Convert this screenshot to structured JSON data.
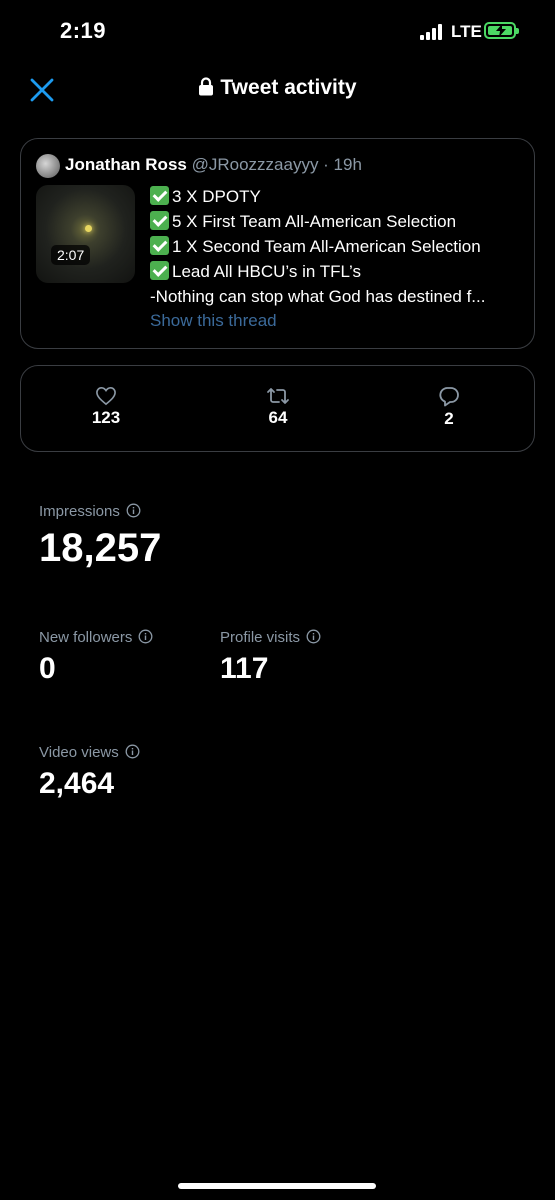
{
  "status_bar": {
    "time": "2:19",
    "network": "LTE"
  },
  "header": {
    "title": "Tweet activity"
  },
  "tweet": {
    "author_name": "Jonathan Ross",
    "meta": "@JRoozzzaayyy · 19h",
    "video_duration": "2:07",
    "lines": [
      "3 X DPOTY",
      "5 X First Team All-American Selection",
      "1 X Second Team All-American Selection",
      "Lead All HBCU’s in TFL’s",
      "-Nothing can stop what God has destined f..."
    ],
    "show_thread": "Show this thread"
  },
  "engagement": {
    "likes": "123",
    "retweets": "64",
    "replies": "2"
  },
  "metrics": {
    "impressions_label": "Impressions",
    "impressions_value": "18,257",
    "new_followers_label": "New followers",
    "new_followers_value": "0",
    "profile_visits_label": "Profile visits",
    "profile_visits_value": "117",
    "video_views_label": "Video views",
    "video_views_value": "2,464"
  },
  "colors": {
    "accent": "#1d9bf0",
    "link": "#3b6a9a",
    "muted": "#8b98a5",
    "battery": "#4cd964",
    "check": "#4cb04f"
  }
}
